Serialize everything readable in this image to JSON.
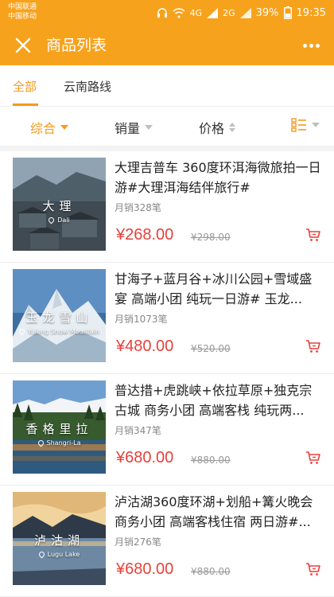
{
  "status": {
    "carrier1": "中国联通",
    "carrier2": "中国移动",
    "net1": "4G",
    "net2": "2G",
    "battery": "39%",
    "time": "19:35"
  },
  "nav": {
    "title": "商品列表",
    "close_icon": "close-icon",
    "more_icon": "more-icon"
  },
  "tabs": [
    {
      "label": "全部",
      "active": true
    },
    {
      "label": "云南路线",
      "active": false
    }
  ],
  "sort": {
    "comprehensive": "综合",
    "sales": "销量",
    "price": "价格",
    "view_icon": "list-view-icon"
  },
  "colors": {
    "accent": "#f7a21c",
    "price": "#e8403a"
  },
  "products": [
    {
      "thumb_title": "大理",
      "thumb_sub": "Dali",
      "title": "大理吉普车 360度环洱海微旅拍一日游#大理洱海结伴旅行#",
      "sales": "月销328笔",
      "price": "¥268.00",
      "original": "¥298.00"
    },
    {
      "thumb_title": "玉龙雪山",
      "thumb_sub": "Yulong Snow Mountain",
      "title": "甘海子+蓝月谷+冰川公园+雪域盛宴 高端小团 纯玩一日游# 玉龙...",
      "sales": "月销1073笔",
      "price": "¥480.00",
      "original": "¥520.00"
    },
    {
      "thumb_title": "香格里拉",
      "thumb_sub": "Shangri-La",
      "title": "普达措+虎跳峡+依拉草原+独克宗古城 商务小团 高端客栈 纯玩两...",
      "sales": "月销347笔",
      "price": "¥680.00",
      "original": "¥880.00"
    },
    {
      "thumb_title": "泸沽湖",
      "thumb_sub": "Lugu Lake",
      "title": "泸沽湖360度环湖+划船+篝火晚会 商务小团 高端客栈住宿 两日游#...",
      "sales": "月销276笔",
      "price": "¥680.00",
      "original": "¥880.00"
    }
  ]
}
